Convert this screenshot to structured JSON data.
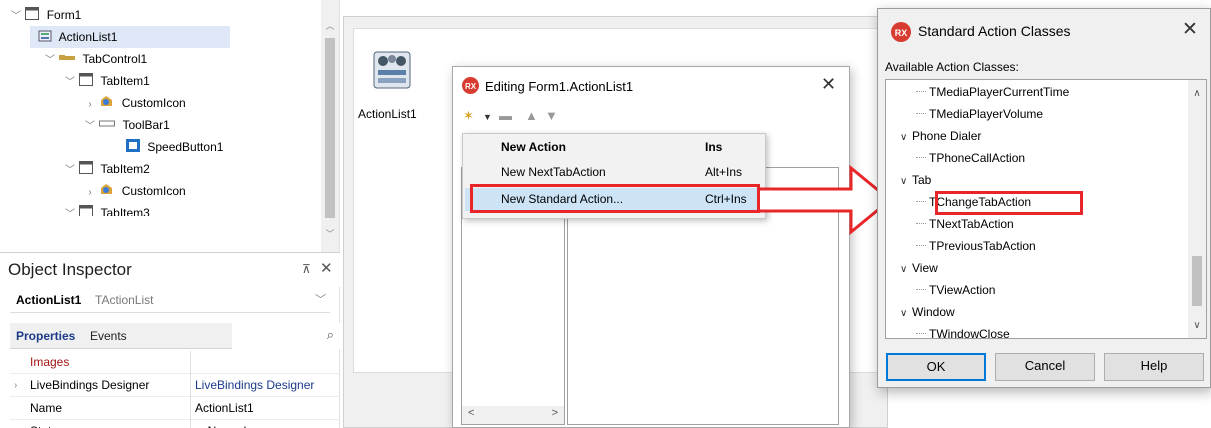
{
  "structure": {
    "items": [
      {
        "label": "Form1",
        "icon": "form-icon",
        "expander": "open"
      },
      {
        "label": "ActionList1",
        "icon": "actionlist-icon",
        "expander": ""
      },
      {
        "label": "TabControl1",
        "icon": "tabcontrol-icon",
        "expander": "open"
      },
      {
        "label": "TabItem1",
        "icon": "tabitem-icon",
        "expander": "open"
      },
      {
        "label": "CustomIcon",
        "icon": "customicon-icon",
        "expander": "closed"
      },
      {
        "label": "ToolBar1",
        "icon": "toolbar-icon",
        "expander": "open"
      },
      {
        "label": "SpeedButton1",
        "icon": "speedbutton-icon",
        "expander": ""
      },
      {
        "label": "TabItem2",
        "icon": "tabitem-icon",
        "expander": "open"
      },
      {
        "label": "CustomIcon",
        "icon": "customicon-icon",
        "expander": "closed"
      },
      {
        "label": "TabItem3",
        "icon": "tabitem-icon",
        "expander": "open"
      }
    ]
  },
  "inspector": {
    "title": "Object Inspector",
    "pin_glyph": "⊼",
    "close_glyph": "✕",
    "selected_name": "ActionList1",
    "selected_class": "TActionList",
    "tabs": {
      "properties": "Properties",
      "events": "Events"
    },
    "properties": [
      {
        "name": "Images",
        "value": "",
        "expandable": false,
        "name_color": "#a31515"
      },
      {
        "name": "LiveBindings Designer",
        "value": "LiveBindings Designer",
        "expandable": true,
        "name_color": "#000000"
      },
      {
        "name": "Name",
        "value": "ActionList1",
        "expandable": false,
        "name_color": "#000000"
      },
      {
        "name": "State",
        "value": "asNormal",
        "expandable": false,
        "name_color": "#000000"
      }
    ]
  },
  "designer": {
    "component_label": "ActionList1"
  },
  "editor": {
    "title": "Editing Form1.ActionList1",
    "close_glyph": "✕",
    "menu": [
      {
        "label": "New Action",
        "shortcut": "Ins"
      },
      {
        "label": "New NextTabAction",
        "shortcut": "Alt+Ins"
      },
      {
        "label": "New Standard Action...",
        "shortcut": "Ctrl+Ins"
      }
    ],
    "scroll_left": "<",
    "scroll_right": ">"
  },
  "std_dialog": {
    "title": "Standard Action Classes",
    "close_glyph": "✕",
    "caption": "Available Action Classes:",
    "tree": [
      {
        "label": "TMediaPlayerCurrentTime",
        "level": 1
      },
      {
        "label": "TMediaPlayerVolume",
        "level": 1
      },
      {
        "label": "Phone Dialer",
        "level": 0
      },
      {
        "label": "TPhoneCallAction",
        "level": 1
      },
      {
        "label": "Tab",
        "level": 0
      },
      {
        "label": "TChangeTabAction",
        "level": 1
      },
      {
        "label": "TNextTabAction",
        "level": 1
      },
      {
        "label": "TPreviousTabAction",
        "level": 1
      },
      {
        "label": "View",
        "level": 0
      },
      {
        "label": "TViewAction",
        "level": 1
      },
      {
        "label": "Window",
        "level": 0
      },
      {
        "label": "TWindowClose",
        "level": 1
      }
    ],
    "buttons": {
      "ok": "OK",
      "cancel": "Cancel",
      "help": "Help"
    }
  },
  "colors": {
    "highlight_red": "#e8262a",
    "menu_selection": "#cde4f7",
    "tree_selection": "#dfe8f6",
    "rx_badge": "#d83b2f",
    "inspector_tab_active": "#1b3a8a"
  }
}
